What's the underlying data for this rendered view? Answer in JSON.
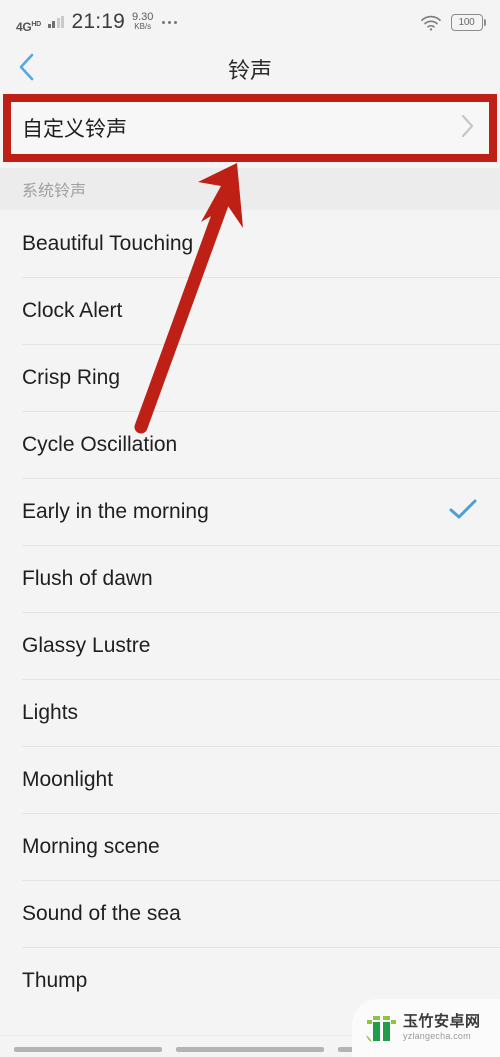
{
  "status_bar": {
    "network_type": "4G",
    "network_suffix": "HD",
    "time": "21:19",
    "data_speed_value": "9.30",
    "data_speed_unit": "KB/s",
    "overflow_icon": "more-dots-icon",
    "wifi_icon": "wifi-icon",
    "battery_level": "100",
    "battery_icon": "battery-icon"
  },
  "header": {
    "back_icon": "chevron-left-icon",
    "title": "铃声",
    "back_color": "#56a9e0"
  },
  "custom_ringtone": {
    "label": "自定义铃声",
    "chevron_icon": "chevron-right-icon",
    "highlight_color": "#bf2015"
  },
  "section": {
    "title": "系统铃声"
  },
  "ringtones": [
    {
      "name": "Beautiful Touching",
      "selected": false
    },
    {
      "name": "Clock Alert",
      "selected": false
    },
    {
      "name": "Crisp Ring",
      "selected": false
    },
    {
      "name": "Cycle Oscillation",
      "selected": false
    },
    {
      "name": "Early in the morning",
      "selected": true
    },
    {
      "name": "Flush of dawn",
      "selected": false
    },
    {
      "name": "Glassy Lustre",
      "selected": false
    },
    {
      "name": "Lights",
      "selected": false
    },
    {
      "name": "Moonlight",
      "selected": false
    },
    {
      "name": "Morning scene",
      "selected": false
    },
    {
      "name": "Sound of the sea",
      "selected": false
    },
    {
      "name": "Thump",
      "selected": false
    }
  ],
  "selection": {
    "check_icon": "check-icon",
    "check_color": "#4d9fd6"
  },
  "annotation": {
    "arrow_icon": "arrow-up-right-icon",
    "arrow_color": "#bf2015"
  },
  "navigation_bar": {
    "icons": [
      "nav-recents-bar",
      "nav-home-bar",
      "nav-back-bar"
    ]
  },
  "watermark": {
    "site_name": "玉竹安卓网",
    "url": "yzlangecha.com",
    "logo_icon": "bamboo-logo-icon",
    "logo_color": "#1f9e4a"
  }
}
